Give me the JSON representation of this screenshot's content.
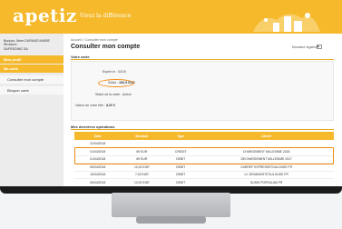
{
  "header": {
    "brand": "apetiz",
    "tagline": "Vivez la différence",
    "colors": {
      "accent": "#f5b92b",
      "highlight": "#f28a10"
    }
  },
  "sidebar": {
    "user_line1": "Bonjour, Mme DURAND MARIE",
    "user_line2": "Structure",
    "user_line3": "SAFREDING SA",
    "items": [
      {
        "label": "Mon profil",
        "highlighted": true
      },
      {
        "label": "Ma carte",
        "highlighted": true
      },
      {
        "label": "Consulter mon compte",
        "highlighted": false
      },
      {
        "label": "Bloquer carte",
        "highlighted": false
      }
    ]
  },
  "main": {
    "breadcrumb": "Accueil > Consulter mon compte",
    "title": "Consulter mon compte",
    "user_tag": "Monsieur legales",
    "card_section": {
      "title": "Votre carte",
      "exp_label": "Expire le :",
      "exp_value": "02/19",
      "solde_label": "Solde :",
      "solde_value": "280,5 EUR",
      "status_label": "Statut de la carte :",
      "status_value": "Active",
      "titre_label": "Valeur de votre titre :",
      "titre_value": "8,00 €"
    },
    "ops_section": {
      "title": "Mes dernières opérations",
      "columns": [
        "Date",
        "Montant",
        "Type",
        "Libellé"
      ],
      "rows": [
        [
          "31/04/2018",
          "",
          "",
          ""
        ],
        [
          "01/04/2018",
          "69 EUR",
          "CREDIT",
          "CHARGEMENT MILLESIME 2018"
        ],
        [
          "01/04/2018",
          "69 EUR",
          "DEBIT",
          "DECHARGEMENT MILLESIME 2017"
        ],
        [
          "06/04/2018",
          "10,40 EUR",
          "DEBIT",
          "CARREF EXPRESS0TOULOUSE FR"
        ],
        [
          "10/04/2018",
          "7,00 EUR",
          "DEBIT",
          "LC DRAMONT0TOULOUSE FR"
        ],
        [
          "06/04/2018",
          "13,00 EUR",
          "DEBIT",
          "SUSHI POPEALAM FR"
        ]
      ]
    }
  }
}
